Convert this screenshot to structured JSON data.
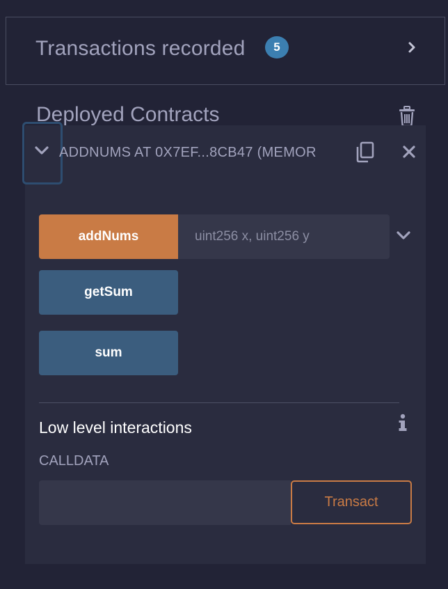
{
  "transactions": {
    "title": "Transactions recorded",
    "count": "5",
    "expand_icon": "chevron-right-icon"
  },
  "deployed": {
    "title": "Deployed Contracts",
    "clear_icon": "trash-icon"
  },
  "contract": {
    "name": "ADDNUMS AT 0X7EF...8CB47 (MEMOR",
    "toggle_icon": "chevron-down-icon",
    "copy_icon": "copy-icon",
    "close_icon": "close-icon",
    "functions": [
      {
        "label": "addNums",
        "kind": "transact",
        "color": "#c97b45",
        "args_placeholder": "uint256 x, uint256 y"
      },
      {
        "label": "getSum",
        "kind": "call",
        "color": "#3b5d7e"
      },
      {
        "label": "sum",
        "kind": "call",
        "color": "#3b5d7e"
      }
    ],
    "low_level": {
      "title": "Low level interactions",
      "info_icon": "info-icon",
      "calldata_label": "CALLDATA",
      "calldata_value": "",
      "transact_label": "Transact"
    }
  },
  "colors": {
    "background": "#222336",
    "card": "#2a2c3f",
    "accent_orange": "#c97b45",
    "accent_blue": "#3b5d7e",
    "badge_blue": "#3c7fb1",
    "muted_text": "#a2a3bd"
  }
}
